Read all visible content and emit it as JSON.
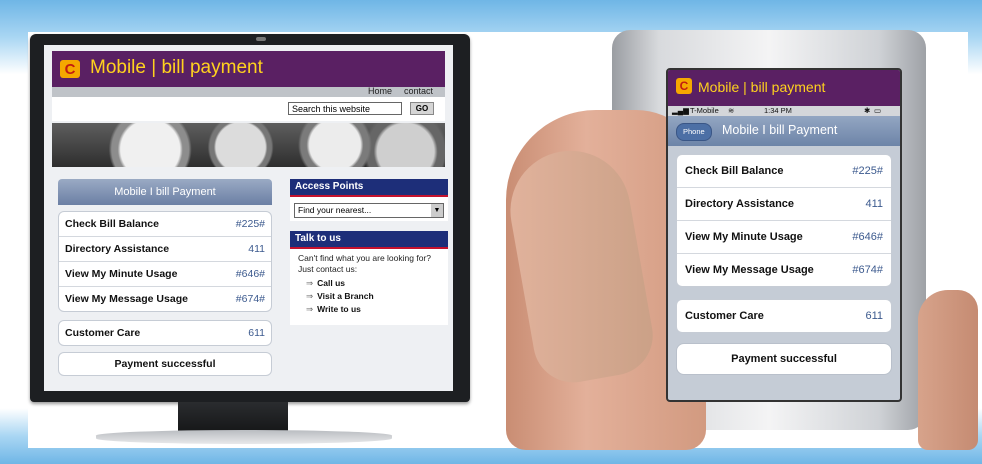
{
  "brand": {
    "logo_letter": "C",
    "name": "Mobile",
    "separator": "|",
    "product": "bill payment"
  },
  "monitor": {
    "nav": {
      "home": "Home",
      "contact": "contact"
    },
    "search": {
      "placeholder": "Search this website",
      "go_label": "GO"
    },
    "panel_title": "Mobile I bill Payment",
    "services": [
      {
        "label": "Check Bill Balance",
        "code": "#225#"
      },
      {
        "label": "Directory Assistance",
        "code": "411"
      },
      {
        "label": "View My Minute Usage",
        "code": "#646#"
      },
      {
        "label": "View My Message Usage",
        "code": "#674#"
      }
    ],
    "customer_care": {
      "label": "Customer Care",
      "code": "611"
    },
    "payment_status": "Payment successful",
    "access_points": {
      "title": "Access Points",
      "select_value": "Find your nearest..."
    },
    "talk": {
      "title": "Talk to us",
      "text": "Can't find what you are looking for? Just contact us:",
      "links": [
        "Call us",
        "Visit a Branch",
        "Write to us"
      ]
    }
  },
  "phone": {
    "status": {
      "carrier": "T-Mobile",
      "time": "1:34 PM"
    },
    "back_label": "Phone",
    "nav_title": "Mobile I bill Payment",
    "services": [
      {
        "label": "Check Bill Balance",
        "code": "#225#"
      },
      {
        "label": "Directory Assistance",
        "code": "411"
      },
      {
        "label": "View My Minute Usage",
        "code": "#646#"
      },
      {
        "label": "View My Message Usage",
        "code": "#674#"
      }
    ],
    "customer_care": {
      "label": "Customer Care",
      "code": "611"
    },
    "payment_status": "Payment successful"
  },
  "colors": {
    "header_purple": "#5a2063",
    "brand_yellow": "#ffd21e",
    "logo_orange": "#f5a800",
    "box_navy": "#1d2e79",
    "accent_red": "#c4122e"
  }
}
